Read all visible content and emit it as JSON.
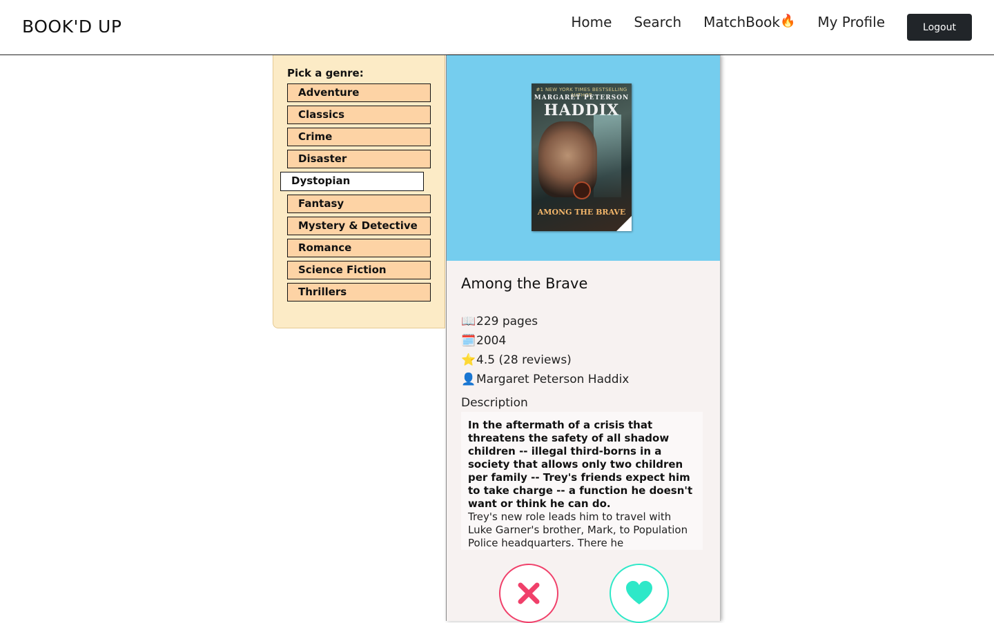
{
  "brand": "BOOK'D UP",
  "nav": {
    "home": "Home",
    "search": "Search",
    "matchbook": "MatchBook",
    "matchbook_icon": "🔥",
    "profile": "My Profile",
    "logout": "Logout"
  },
  "genres": {
    "title": "Pick a genre:",
    "items": [
      "Adventure",
      "Classics",
      "Crime",
      "Disaster",
      "Dystopian",
      "Fantasy",
      "Mystery & Detective",
      "Romance",
      "Science Fiction",
      "Thrillers"
    ],
    "selected": "Dystopian"
  },
  "book": {
    "cover": {
      "tagline": "#1 NEW YORK TIMES BESTSELLING AUTHOR",
      "author": "MARGARET PETERSON",
      "author_last": "HADDIX",
      "title": "AMONG THE BRAVE"
    },
    "title": "Among the Brave",
    "pages": "229 pages",
    "year": "2004",
    "rating": "4.5 (28 reviews)",
    "author": "Margaret Peterson Haddix",
    "description_label": "Description",
    "description_bold": "In the aftermath of a crisis that threatens the safety of all shadow children -- illegal third-borns in a society that allows only two children per family -- Trey's friends expect him to take charge -- a function he doesn't want or think he can do.",
    "description_rest": "Trey's new role leads him to travel with Luke Garner's brother, Mark, to Population Police headquarters. There he"
  },
  "icons": {
    "pages": "📖",
    "year": "🗓️",
    "rating": "⭐",
    "author": "👤"
  },
  "colors": {
    "reject": "#f0406a",
    "like": "#2ee8c8",
    "cover_bg": "#75cdee",
    "genre_panel": "#fcebc6",
    "genre_button": "#fdd3a5"
  }
}
